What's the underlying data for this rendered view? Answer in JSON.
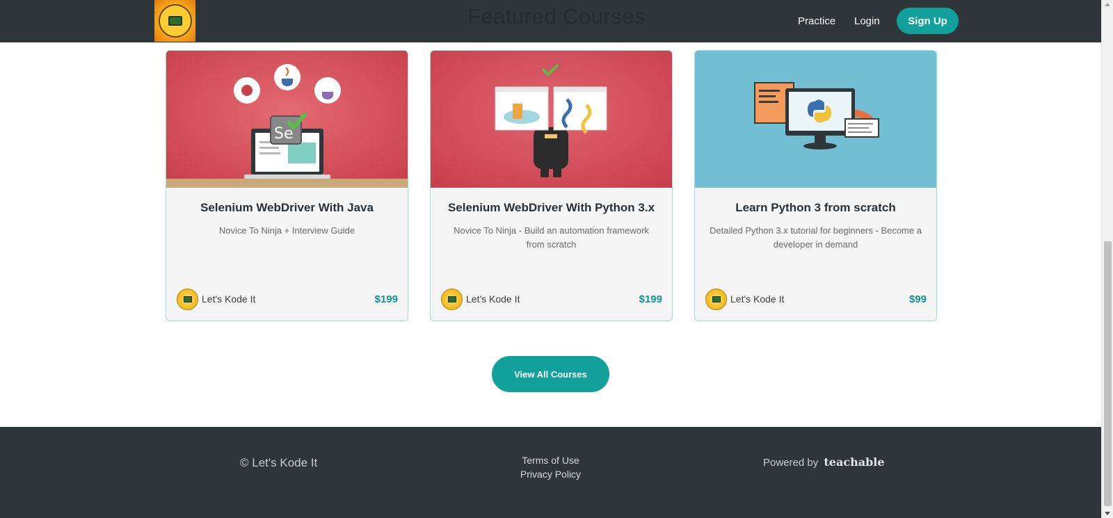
{
  "header": {
    "logo_alt": "Let's Kode It",
    "faded_title": "Featured Courses",
    "nav": {
      "practice": "Practice",
      "login": "Login",
      "signup": "Sign Up"
    }
  },
  "courses": [
    {
      "title": "Selenium WebDriver With Java",
      "subtitle": "Novice To Ninja + Interview Guide",
      "author": "Let's Kode It",
      "price": "$199",
      "image_color": "#d04a55",
      "image_icon": "selenium-java-laptop-icon"
    },
    {
      "title": "Selenium WebDriver With Python 3.x",
      "subtitle": "Novice To Ninja - Build an automation framework from scratch",
      "author": "Let's Kode It",
      "price": "$199",
      "image_color": "#d14a55",
      "image_icon": "python-ninja-icon"
    },
    {
      "title": "Learn Python 3 from scratch",
      "subtitle": "Detailed Python 3.x tutorial for beginners - Become a developer in demand",
      "author": "Let's Kode It",
      "price": "$99",
      "image_color": "#72bfd3",
      "image_icon": "python-monitor-icon"
    }
  ],
  "view_all_label": "View All Courses",
  "footer": {
    "copyright": "© Let's Kode It",
    "terms": "Terms of Use",
    "privacy": "Privacy Policy",
    "powered_by": "Powered by",
    "brand": "teachable"
  },
  "colors": {
    "accent": "#12a19a",
    "dark": "#2f3639",
    "card_border": "#9de0da"
  }
}
